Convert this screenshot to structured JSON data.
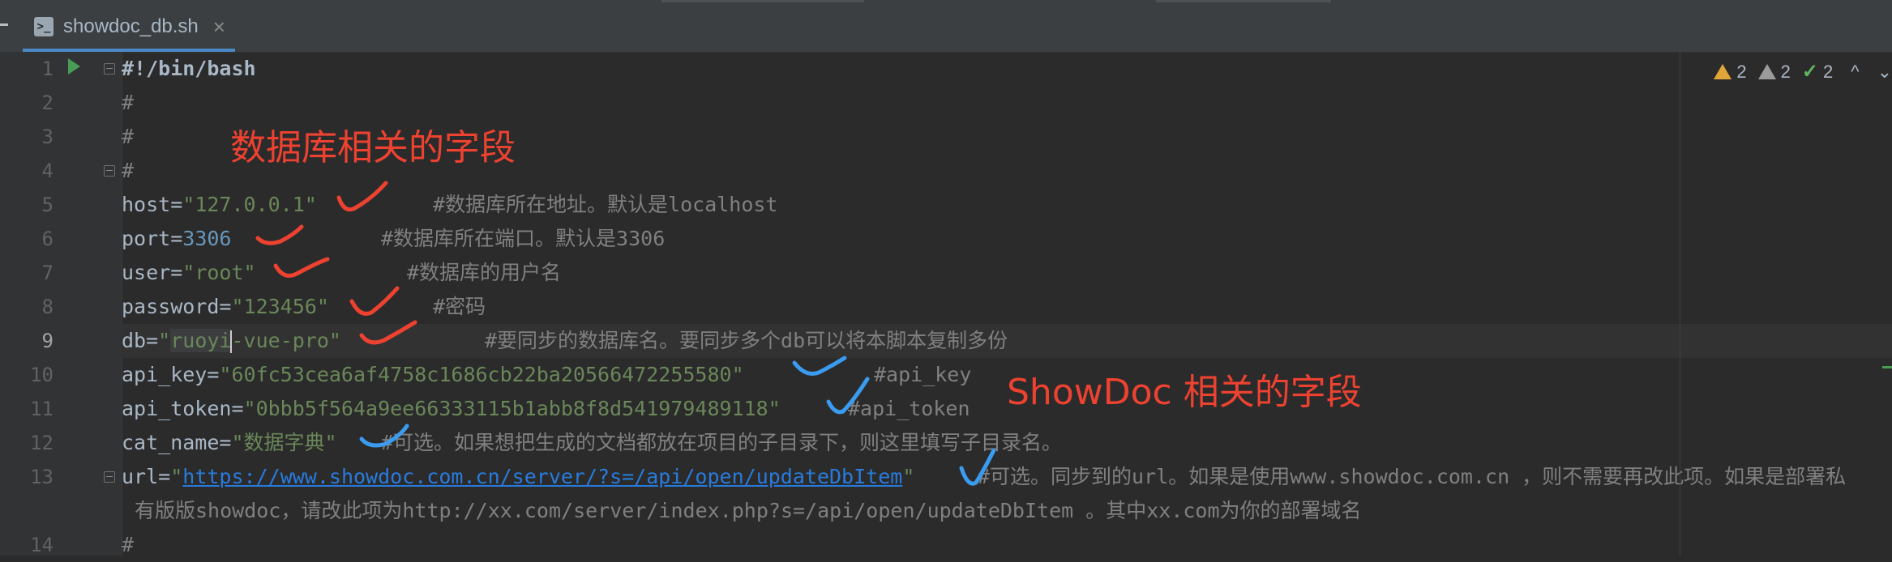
{
  "tab": {
    "file_name": "showdoc_db.sh",
    "close_glyph": "×",
    "icon": "shell-script-file-icon"
  },
  "gutter": {
    "line_numbers": [
      "1",
      "2",
      "3",
      "4",
      "5",
      "6",
      "7",
      "8",
      "9",
      "10",
      "11",
      "12",
      "13",
      "",
      "14"
    ]
  },
  "inspections": {
    "warnings": "2",
    "weak_warnings": "2",
    "typos": "2",
    "up_glyph": "^",
    "down_glyph": "⌄"
  },
  "code": {
    "l1": "#!/bin/bash",
    "l2": "#",
    "l3": "#",
    "l4": "#",
    "l5_key": "host=",
    "l5_val": "\"127.0.0.1\"",
    "l5_comment": "#数据库所在地址。默认是localhost",
    "l6_key": "port=",
    "l6_val": "3306",
    "l6_comment": "#数据库所在端口。默认是3306",
    "l7_key": "user=",
    "l7_val": "\"root\"",
    "l7_comment": "#数据库的用户名",
    "l8_key": "password=",
    "l8_val": "\"123456\"",
    "l8_comment": "#密码",
    "l9_key": "db=",
    "l9_q1": "\"",
    "l9_sel": "ruoyi",
    "l9_rest": "-vue-pro\"",
    "l9_comment": "#要同步的数据库名。要同步多个db可以将本脚本复制多份",
    "l10_key": "api_key=",
    "l10_val": "\"60fc53cea6af4758c1686cb22ba20566472255580\"",
    "l10_comment": "#api_key",
    "l11_key": "api_token=",
    "l11_val": "\"0bbb5f564a9ee66333115b1abb8f8d541979489118\"",
    "l11_comment": "#api_token",
    "l12_key": "cat_name=",
    "l12_val": "\"数据字典\"",
    "l12_comment": "#可选。如果想把生成的文档都放在项目的子目录下，则这里填写子目录名。",
    "l13_key": "url=",
    "l13_q1": "\"",
    "l13_url": "https://www.showdoc.com.cn/server/?s=/api/open/updateDbItem",
    "l13_q2": "\"",
    "l13_comment": "#可选。同步到的url。如果是使用www.showdoc.com.cn ，则不需要再改此项。如果是部署私",
    "l13_wrap": "有版版showdoc，请改此项为http://xx.com/server/index.php?s=/api/open/updateDbItem 。其中xx.com为你的部署域名",
    "l14": "#"
  },
  "annotations": {
    "db_fields": "数据库相关的字段",
    "showdoc_fields": "ShowDoc 相关的字段"
  },
  "colors": {
    "red_mark": "#ee4231",
    "blue_mark": "#3a9bef"
  }
}
